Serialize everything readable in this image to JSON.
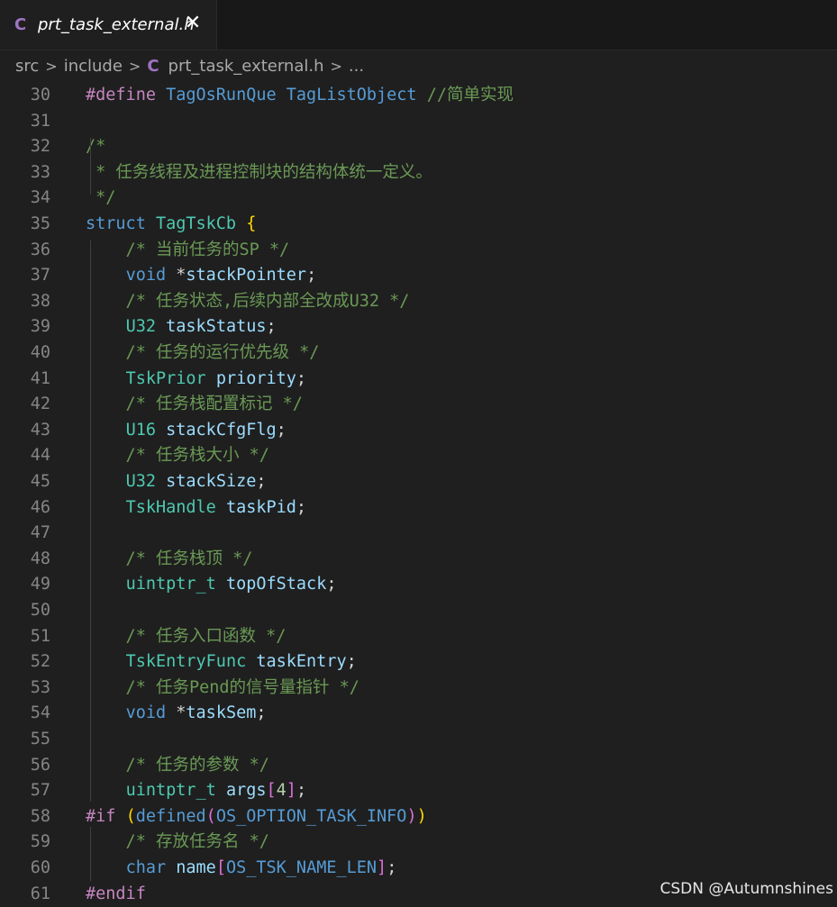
{
  "tab": {
    "icon": "C",
    "title": "prt_task_external.h"
  },
  "breadcrumb": {
    "src": "src",
    "include": "include",
    "icon": "C",
    "file": "prt_task_external.h",
    "more": "..."
  },
  "watermark": "CSDN @Autumnshines",
  "lines": [
    {
      "n": "30",
      "t": [
        [
          "kw-pink",
          "#define "
        ],
        [
          "macro",
          "TagOsRunQue"
        ],
        [
          "punct",
          " "
        ],
        [
          "macro",
          "TagListObject"
        ],
        [
          "punct",
          " "
        ],
        [
          "comment",
          "//简单实现"
        ]
      ]
    },
    {
      "n": "31",
      "t": []
    },
    {
      "n": "32",
      "t": [
        [
          "comment",
          "/*"
        ]
      ]
    },
    {
      "n": "33",
      "t": [
        [
          "comment",
          " * 任务线程及进程控制块的结构体统一定义。"
        ]
      ]
    },
    {
      "n": "34",
      "t": [
        [
          "comment",
          " */"
        ]
      ]
    },
    {
      "n": "35",
      "t": [
        [
          "kw-blue",
          "struct "
        ],
        [
          "type",
          "TagTskCb"
        ],
        [
          "punct",
          " "
        ],
        [
          "brace",
          "{"
        ]
      ]
    },
    {
      "n": "36",
      "t": [
        [
          "comment",
          "    /* 当前任务的SP */"
        ]
      ]
    },
    {
      "n": "37",
      "t": [
        [
          "punct",
          "    "
        ],
        [
          "kw-blue",
          "void"
        ],
        [
          "punct",
          " *"
        ],
        [
          "ident",
          "stackPointer"
        ],
        [
          "punct",
          ";"
        ]
      ]
    },
    {
      "n": "38",
      "t": [
        [
          "comment",
          "    /* 任务状态,后续内部全改成U32 */"
        ]
      ]
    },
    {
      "n": "39",
      "t": [
        [
          "punct",
          "    "
        ],
        [
          "type",
          "U32"
        ],
        [
          "punct",
          " "
        ],
        [
          "ident",
          "taskStatus"
        ],
        [
          "punct",
          ";"
        ]
      ]
    },
    {
      "n": "40",
      "t": [
        [
          "comment",
          "    /* 任务的运行优先级 */"
        ]
      ]
    },
    {
      "n": "41",
      "t": [
        [
          "punct",
          "    "
        ],
        [
          "type",
          "TskPrior"
        ],
        [
          "punct",
          " "
        ],
        [
          "ident",
          "priority"
        ],
        [
          "punct",
          ";"
        ]
      ]
    },
    {
      "n": "42",
      "t": [
        [
          "comment",
          "    /* 任务栈配置标记 */"
        ]
      ]
    },
    {
      "n": "43",
      "t": [
        [
          "punct",
          "    "
        ],
        [
          "type",
          "U16"
        ],
        [
          "punct",
          " "
        ],
        [
          "ident",
          "stackCfgFlg"
        ],
        [
          "punct",
          ";"
        ]
      ]
    },
    {
      "n": "44",
      "t": [
        [
          "comment",
          "    /* 任务栈大小 */"
        ]
      ]
    },
    {
      "n": "45",
      "t": [
        [
          "punct",
          "    "
        ],
        [
          "type",
          "U32"
        ],
        [
          "punct",
          " "
        ],
        [
          "ident",
          "stackSize"
        ],
        [
          "punct",
          ";"
        ]
      ]
    },
    {
      "n": "46",
      "t": [
        [
          "punct",
          "    "
        ],
        [
          "type",
          "TskHandle"
        ],
        [
          "punct",
          " "
        ],
        [
          "ident",
          "taskPid"
        ],
        [
          "punct",
          ";"
        ]
      ]
    },
    {
      "n": "47",
      "t": []
    },
    {
      "n": "48",
      "t": [
        [
          "comment",
          "    /* 任务栈顶 */"
        ]
      ]
    },
    {
      "n": "49",
      "t": [
        [
          "punct",
          "    "
        ],
        [
          "type",
          "uintptr_t"
        ],
        [
          "punct",
          " "
        ],
        [
          "ident",
          "topOfStack"
        ],
        [
          "punct",
          ";"
        ]
      ]
    },
    {
      "n": "50",
      "t": []
    },
    {
      "n": "51",
      "t": [
        [
          "comment",
          "    /* 任务入口函数 */"
        ]
      ]
    },
    {
      "n": "52",
      "t": [
        [
          "punct",
          "    "
        ],
        [
          "type",
          "TskEntryFunc"
        ],
        [
          "punct",
          " "
        ],
        [
          "ident",
          "taskEntry"
        ],
        [
          "punct",
          ";"
        ]
      ]
    },
    {
      "n": "53",
      "t": [
        [
          "comment",
          "    /* 任务Pend的信号量指针 */"
        ]
      ]
    },
    {
      "n": "54",
      "t": [
        [
          "punct",
          "    "
        ],
        [
          "kw-blue",
          "void"
        ],
        [
          "punct",
          " *"
        ],
        [
          "ident",
          "taskSem"
        ],
        [
          "punct",
          ";"
        ]
      ]
    },
    {
      "n": "55",
      "t": []
    },
    {
      "n": "56",
      "t": [
        [
          "comment",
          "    /* 任务的参数 */"
        ]
      ]
    },
    {
      "n": "57",
      "t": [
        [
          "punct",
          "    "
        ],
        [
          "type",
          "uintptr_t"
        ],
        [
          "punct",
          " "
        ],
        [
          "ident",
          "args"
        ],
        [
          "paren",
          "["
        ],
        [
          "num",
          "4"
        ],
        [
          "paren",
          "]"
        ],
        [
          "punct",
          ";"
        ]
      ]
    },
    {
      "n": "58",
      "t": [
        [
          "kw-pink",
          "#if"
        ],
        [
          "punct",
          " "
        ],
        [
          "brace",
          "("
        ],
        [
          "kw-blue",
          "defined"
        ],
        [
          "paren",
          "("
        ],
        [
          "macro",
          "OS_OPTION_TASK_INFO"
        ],
        [
          "paren",
          ")"
        ],
        [
          "brace",
          ")"
        ]
      ]
    },
    {
      "n": "59",
      "t": [
        [
          "comment",
          "    /* 存放任务名 */"
        ]
      ]
    },
    {
      "n": "60",
      "t": [
        [
          "punct",
          "    "
        ],
        [
          "kw-blue",
          "char"
        ],
        [
          "punct",
          " "
        ],
        [
          "ident",
          "name"
        ],
        [
          "paren",
          "["
        ],
        [
          "macro",
          "OS_TSK_NAME_LEN"
        ],
        [
          "paren",
          "]"
        ],
        [
          "punct",
          ";"
        ]
      ]
    },
    {
      "n": "61",
      "t": [
        [
          "kw-pink",
          "#endif"
        ]
      ]
    }
  ]
}
